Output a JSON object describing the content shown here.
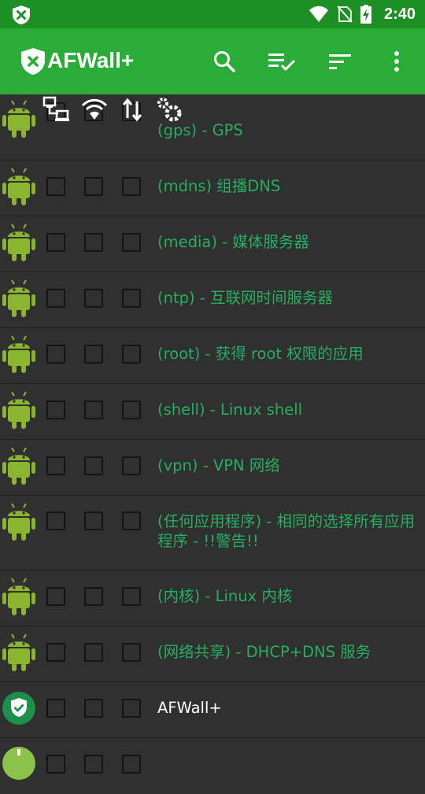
{
  "status_bar": {
    "time": "2:40",
    "icons": [
      "afwall-notification-icon",
      "wifi-icon",
      "no-sim-icon",
      "battery-charging-icon"
    ]
  },
  "app_bar": {
    "title": "AFWall+",
    "actions": [
      "search-icon",
      "select-all-icon",
      "sort-icon",
      "more-vert-icon"
    ]
  },
  "columns": [
    "lan-icon",
    "wifi-icon",
    "mobile-data-icon",
    "vpn-settings-icon"
  ],
  "apps": [
    {
      "name": "(gps) - GPS",
      "icon": "android-icon",
      "style": "system"
    },
    {
      "name": "(mdns) 组播DNS",
      "icon": "android-icon",
      "style": "system"
    },
    {
      "name": "(media) - 媒体服务器",
      "icon": "android-icon",
      "style": "system"
    },
    {
      "name": "(ntp) - 互联网时间服务器",
      "icon": "android-icon",
      "style": "system"
    },
    {
      "name": "(root) - 获得 root 权限的应用",
      "icon": "android-icon",
      "style": "system"
    },
    {
      "name": "(shell) - Linux shell",
      "icon": "android-icon",
      "style": "system"
    },
    {
      "name": "(vpn) - VPN 网络",
      "icon": "android-icon",
      "style": "system"
    },
    {
      "name": "(任何应用程序) - 相同的选择所有应用程序 - !!警告!!",
      "icon": "android-icon",
      "style": "system"
    },
    {
      "name": "(内核) - Linux 内核",
      "icon": "android-icon",
      "style": "system"
    },
    {
      "name": "(网络共享) - DHCP+DNS 服务",
      "icon": "android-icon",
      "style": "system"
    },
    {
      "name": "AFWall+",
      "icon": "afwall-shield-icon",
      "style": "user"
    },
    {
      "name": "",
      "icon": "app-icon",
      "style": "user"
    }
  ],
  "colors": {
    "status_bar": "#1e8f24",
    "app_bar": "#2aac39",
    "background": "#303030",
    "system_app_text": "#27ae60",
    "user_app_text": "#ffffff",
    "android_green": "#8bb52f"
  }
}
